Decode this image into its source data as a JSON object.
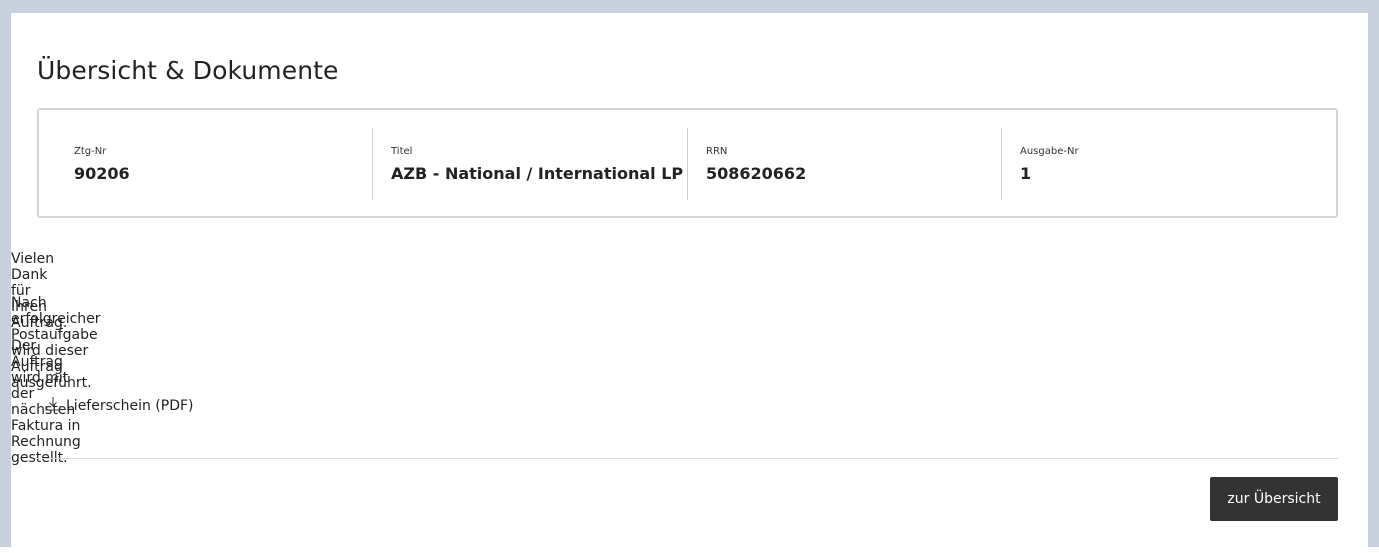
{
  "page": {
    "title": "Übersicht & Dokumente"
  },
  "info": {
    "ztg_label": "Ztg-Nr",
    "ztg_value": "90206",
    "titel_label": "Titel",
    "titel_value": "AZB - National / International LP",
    "rrn_label": "RRN",
    "rrn_value": "508620662",
    "ausgabe_label": "Ausgabe-Nr",
    "ausgabe_value": "1"
  },
  "messages": {
    "thanks": "Vielen Dank für Ihren Auftrag.",
    "execution": "Nach erfolgreicher Postaufgabe wird dieser Auftrag ausgeführt.",
    "billing": "Der Auftrag wird mit der nächsten Faktura in Rechnung gestellt."
  },
  "download": {
    "label": "Lieferschein (PDF)",
    "icon": "download-icon"
  },
  "actions": {
    "overview_button": "zur Übersicht"
  }
}
